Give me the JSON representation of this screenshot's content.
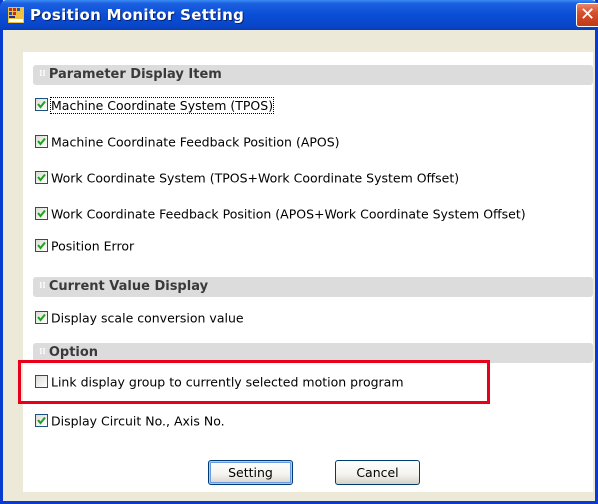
{
  "window": {
    "title": "Position Monitor Setting",
    "close_icon": "close-x-icon",
    "app_icon": "app-grid-icon",
    "title_color": "#0a4ed6",
    "close_color": "#d4502e"
  },
  "sections": {
    "parameter": {
      "title": "Parameter Display Item",
      "items": [
        {
          "label": "Machine Coordinate System (TPOS)",
          "checked": true
        },
        {
          "label": "Machine Coordinate Feedback Position (APOS)",
          "checked": true
        },
        {
          "label": "Work Coordinate System (TPOS+Work Coordinate System Offset)",
          "checked": true
        },
        {
          "label": "Work Coordinate Feedback Position (APOS+Work Coordinate System Offset)",
          "checked": true
        },
        {
          "label": "Position Error",
          "checked": true
        }
      ]
    },
    "current": {
      "title": "Current Value Display",
      "items": [
        {
          "label": "Display scale conversion value",
          "checked": true
        }
      ]
    },
    "option": {
      "title": "Option",
      "items": [
        {
          "label": "Link display group to currently selected motion program",
          "checked": false
        },
        {
          "label": "Display Circuit No., Axis No.",
          "checked": true
        }
      ]
    }
  },
  "buttons": {
    "setting": "Setting",
    "cancel": "Cancel"
  },
  "highlight_color": "#e8001a"
}
